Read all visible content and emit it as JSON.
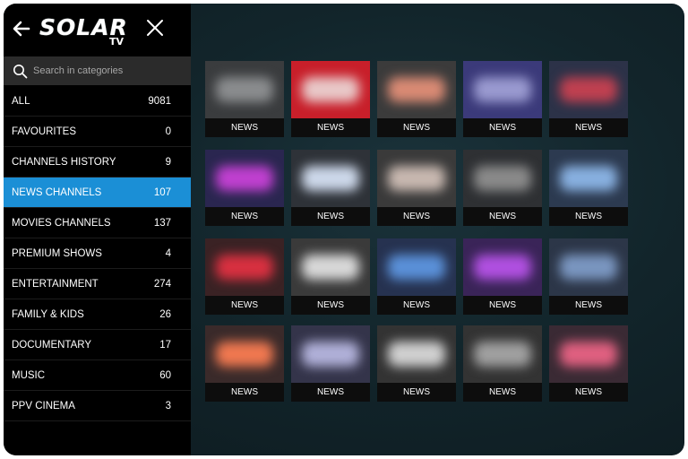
{
  "header": {
    "logo_text": "SOLAR",
    "logo_sub": "TV",
    "back_icon": "arrow-left-icon",
    "close_icon": "close-icon"
  },
  "search": {
    "placeholder": "Search in categories",
    "icon": "search-icon"
  },
  "colors": {
    "active": "#1b8fd6",
    "sidebar_bg": "#000000",
    "search_bg": "#2b2b2b",
    "content_bg": "#12252b"
  },
  "categories": [
    {
      "label": "ALL",
      "count": "9081",
      "active": false
    },
    {
      "label": "FAVOURITES",
      "count": "0",
      "active": false
    },
    {
      "label": "CHANNELS HISTORY",
      "count": "9",
      "active": false
    },
    {
      "label": "NEWS CHANNELS",
      "count": "107",
      "active": true
    },
    {
      "label": "MOVIES CHANNELS",
      "count": "137",
      "active": false
    },
    {
      "label": "PREMIUM SHOWS",
      "count": "4",
      "active": false
    },
    {
      "label": "ENTERTAINMENT",
      "count": "274",
      "active": false
    },
    {
      "label": "FAMILY & KIDS",
      "count": "26",
      "active": false
    },
    {
      "label": "DOCUMENTARY",
      "count": "17",
      "active": false
    },
    {
      "label": "MUSIC",
      "count": "60",
      "active": false
    },
    {
      "label": "PPV CINEMA",
      "count": "3",
      "active": false
    }
  ],
  "channels": [
    {
      "label": "NEWS",
      "thumb_bg": "#3a3c3e",
      "blob": "#8a8c8e"
    },
    {
      "label": "NEWS",
      "thumb_bg": "#c81f2a",
      "blob": "#e8c8c8"
    },
    {
      "label": "NEWS",
      "thumb_bg": "#3b3b3b",
      "blob": "#d98a74"
    },
    {
      "label": "NEWS",
      "thumb_bg": "#3b3a7a",
      "blob": "#9a9ad0"
    },
    {
      "label": "NEWS",
      "thumb_bg": "#2c3248",
      "blob": "#c04050"
    },
    {
      "label": "NEWS",
      "thumb_bg": "#2a2650",
      "blob": "#c040d0"
    },
    {
      "label": "NEWS",
      "thumb_bg": "#2e3238",
      "blob": "#cdd8ea"
    },
    {
      "label": "NEWS",
      "thumb_bg": "#3a3a3a",
      "blob": "#c8b8b0"
    },
    {
      "label": "NEWS",
      "thumb_bg": "#2e3033",
      "blob": "#8a8a8a"
    },
    {
      "label": "NEWS",
      "thumb_bg": "#2c3a50",
      "blob": "#88b0e0"
    },
    {
      "label": "NEWS",
      "thumb_bg": "#3a2224",
      "blob": "#d83040"
    },
    {
      "label": "NEWS",
      "thumb_bg": "#3a3a3a",
      "blob": "#d8d8d8"
    },
    {
      "label": "NEWS",
      "thumb_bg": "#263250",
      "blob": "#5a90d8"
    },
    {
      "label": "NEWS",
      "thumb_bg": "#3a2458",
      "blob": "#b050e0"
    },
    {
      "label": "NEWS",
      "thumb_bg": "#2c3648",
      "blob": "#7a96c0"
    },
    {
      "label": "NEWS",
      "thumb_bg": "#3a2a2a",
      "blob": "#f07850"
    },
    {
      "label": "NEWS",
      "thumb_bg": "#34344a",
      "blob": "#b0b0d8"
    },
    {
      "label": "NEWS",
      "thumb_bg": "#333333",
      "blob": "#d0d0d0"
    },
    {
      "label": "NEWS",
      "thumb_bg": "#333333",
      "blob": "#a0a0a0"
    },
    {
      "label": "NEWS",
      "thumb_bg": "#3a2a34",
      "blob": "#e06080"
    }
  ]
}
